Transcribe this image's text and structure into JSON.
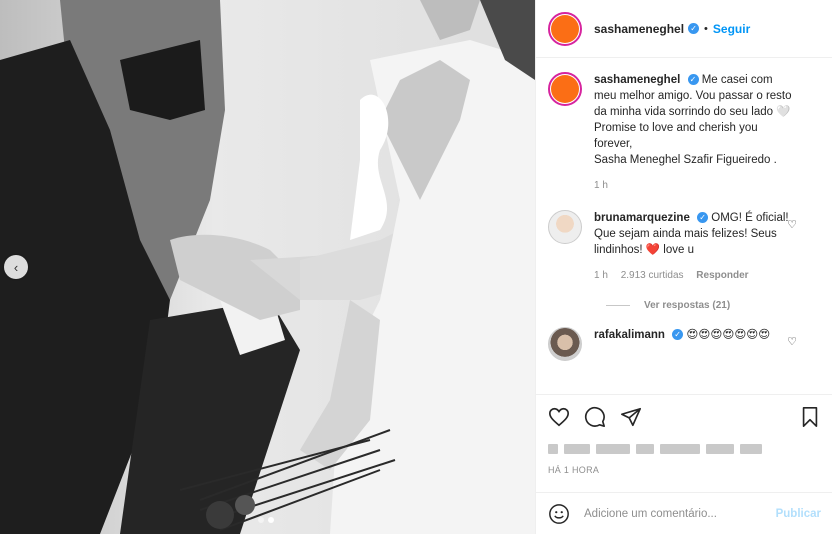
{
  "post": {
    "author": "sashameneghel",
    "follow_label": "Seguir",
    "separator": "•",
    "caption": "Me casei com meu melhor amigo. Vou passar o resto da minha vida sorrindo do seu lado 🤍 Promise to love and cherish you forever,",
    "caption_tail": "Sasha Meneghel Szafir Figueiredo .",
    "caption_time": "1 h",
    "time_ago": "HÁ 1 HORA"
  },
  "comments": [
    {
      "user": "brunamarquezine",
      "text": "OMG! É oficial! Que sejam ainda mais felizes! Seus lindinhos! ❤️ love u",
      "time": "1 h",
      "likes": "2.913 curtidas",
      "reply_label": "Responder",
      "view_replies": "Ver respostas (21)"
    },
    {
      "user": "rafakalimann",
      "text": "😍😍😍😍😍😍😍"
    }
  ],
  "add_comment": {
    "placeholder": "Adicione um comentário...",
    "publish_label": "Publicar"
  },
  "colors": {
    "accent": "#0095f6",
    "avatar_orange": "#fb6e15",
    "verified": "#3897f0"
  },
  "icons": [
    "heart-icon",
    "comment-icon",
    "share-icon",
    "bookmark-icon",
    "emoji-icon",
    "chevron-left-icon"
  ]
}
